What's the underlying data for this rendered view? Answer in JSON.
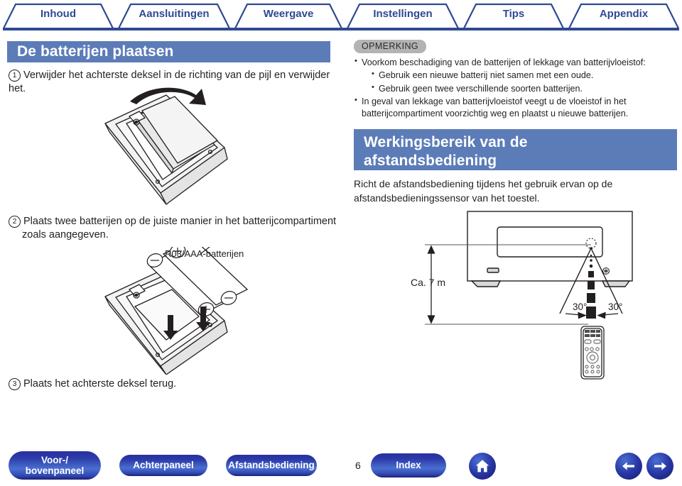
{
  "tabs": [
    {
      "label": "Inhoud"
    },
    {
      "label": "Aansluitingen"
    },
    {
      "label": "Weergave"
    },
    {
      "label": "Instellingen"
    },
    {
      "label": "Tips"
    },
    {
      "label": "Appendix"
    }
  ],
  "headings": {
    "batteries": "De batterijen plaatsen",
    "range_line1": "Werkingsbereik van de",
    "range_line2": "afstandsbediening"
  },
  "steps": {
    "step1_num": "1",
    "step1_text": "Verwijder het achterste deksel in de richting van de pijl en verwijder het.",
    "step2_num": "2",
    "step2_text": "Plaats twee batterijen op de juiste manier in het batterijcompartiment",
    "step2_text_line2": "zoals aangegeven.",
    "step3_num": "3",
    "step3_text": "Plaats het achterste deksel terug."
  },
  "note": {
    "badge": "OPMERKING",
    "items": [
      "Voorkom beschadiging van de batterijen of lekkage van batterijvloeistof:",
      "Gebruik een nieuwe batterij niet samen met een oude.",
      "Gebruik geen twee verschillende soorten batterijen.",
      "In geval van lekkage van batterijvloeistof veegt u de vloeistof in het",
      "batterijcompartiment voorzichtig weg en plaatst u nieuwe batterijen."
    ]
  },
  "range": {
    "body_line1": "Richt de afstandsbediening tijdens het gebruik ervan op de",
    "body_line2": "afstandsbedieningssensor van het toestel.",
    "distance_label": "Ca. 7 m",
    "angle_left": "30°",
    "angle_right": "30°"
  },
  "figures": {
    "battery_caption": "R03/AAA-batterijen"
  },
  "bottom_nav": {
    "buttons": [
      {
        "label_line1": "Voor-/",
        "label_line2": "bovenpaneel"
      },
      {
        "label_line1": "Achterpaneel",
        "label_line2": ""
      },
      {
        "label_line1": "Afstandsbediening",
        "label_line2": ""
      },
      {
        "label_line1": "Index",
        "label_line2": ""
      }
    ],
    "page_number": "6",
    "home_icon": "home-icon",
    "prev_icon": "arrow-left-icon",
    "next_icon": "arrow-right-icon"
  },
  "colors": {
    "tab_blue": "#2e4a93",
    "heading_blue": "#5c7cb8",
    "note_gray": "#b3b3b3",
    "button_blue": "#2a39a8"
  }
}
